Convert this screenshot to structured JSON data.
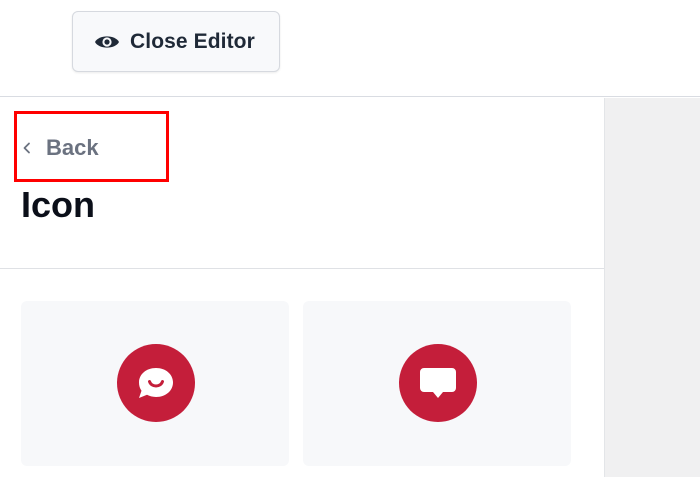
{
  "toolbar": {
    "close_editor_label": "Close Editor",
    "close_editor_icon": "eye-icon"
  },
  "sidebar": {
    "back_label": "Back",
    "back_icon": "chevron-left-icon",
    "title": "Icon",
    "icon_options": [
      {
        "icon": "chat-bubble-smile-icon",
        "color": "#c41e3a"
      },
      {
        "icon": "chat-bubble-icon",
        "color": "#c41e3a"
      }
    ]
  },
  "colors": {
    "accent": "#c41e3a",
    "highlight": "#ff0000",
    "muted_text": "#6b7280",
    "panel_bg": "#f0f0f1"
  }
}
